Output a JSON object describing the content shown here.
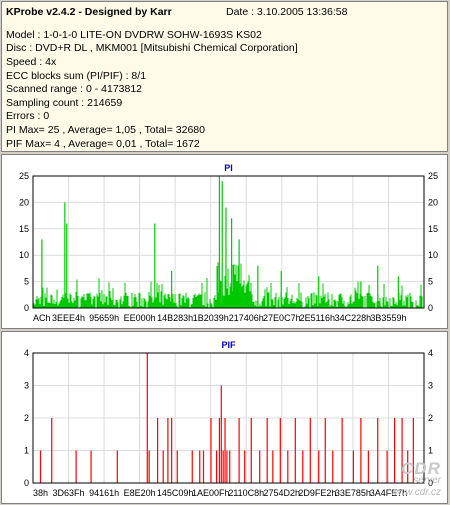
{
  "header": {
    "title": "KProbe v2.4.2 - Designed by Karr",
    "date": "Date : 3.10.2005 13:36:58",
    "lines": [
      "Model : 1-0-1-0 LITE-ON DVDRW SOHW-1693S KS02",
      "Disc : DVD+R DL , MKM001 [Mitsubishi Chemical Corporation]",
      "Speed : 4x",
      "ECC blocks sum (PI/PIF) : 8/1",
      "Scanned range : 0 - 4173812",
      "Sampling count : 214659",
      "Errors : 0",
      "PI Max= 25 , Average= 1,05 , Total= 32680",
      "PIF Max= 4 , Average= 0,01 , Total= 1672"
    ]
  },
  "watermark": {
    "logo": "CDR",
    "sub": "server",
    "url": "www.cdr.cz"
  },
  "colors": {
    "pi": "#00c800",
    "pif": "#ff0000",
    "grid": "#dcdcdc",
    "axis_text": "#000000",
    "title": "#0000c0"
  },
  "chart_data": [
    {
      "type": "bar",
      "title": "PI",
      "ylim": [
        0,
        25
      ],
      "yticks": [
        0,
        5,
        10,
        15,
        20,
        25
      ],
      "x_tick_labels": [
        "ACh",
        "3EEE4h",
        "95659h",
        "EE000h",
        "14B283h",
        "1B2039h",
        "217406h",
        "27E0C7h",
        "2E5116h",
        "34C228h",
        "3B3559h"
      ],
      "x_range": [
        0,
        4173812
      ],
      "peaks": [
        {
          "x": 95000,
          "y": 13
        },
        {
          "x": 340000,
          "y": 20
        },
        {
          "x": 360000,
          "y": 16
        },
        {
          "x": 1300000,
          "y": 16
        },
        {
          "x": 1480000,
          "y": 7
        },
        {
          "x": 1990000,
          "y": 25
        },
        {
          "x": 2020000,
          "y": 24
        },
        {
          "x": 2060000,
          "y": 19
        },
        {
          "x": 2120000,
          "y": 17
        },
        {
          "x": 2200000,
          "y": 13
        },
        {
          "x": 2400000,
          "y": 8
        },
        {
          "x": 2650000,
          "y": 7
        },
        {
          "x": 3050000,
          "y": 6
        },
        {
          "x": 3500000,
          "y": 5
        },
        {
          "x": 3680000,
          "y": 8
        },
        {
          "x": 3900000,
          "y": 6
        }
      ],
      "baseline_average": 1.05
    },
    {
      "type": "bar",
      "title": "PIF",
      "ylim": [
        0,
        4
      ],
      "yticks": [
        0,
        1,
        2,
        3,
        4
      ],
      "x_tick_labels": [
        "38h",
        "3D63Fh",
        "94161h",
        "E8E20h",
        "145C09h",
        "1AE00Fh",
        "2110C8h",
        "2754D2h",
        "2D9FE2h",
        "33E785h",
        "3A4FE7h"
      ],
      "x_range": [
        0,
        4173812
      ],
      "values": [
        {
          "x": 80000,
          "y": 1
        },
        {
          "x": 200000,
          "y": 2
        },
        {
          "x": 460000,
          "y": 1
        },
        {
          "x": 620000,
          "y": 1
        },
        {
          "x": 900000,
          "y": 1
        },
        {
          "x": 1220000,
          "y": 4
        },
        {
          "x": 1240000,
          "y": 1
        },
        {
          "x": 1330000,
          "y": 2
        },
        {
          "x": 1390000,
          "y": 1
        },
        {
          "x": 1440000,
          "y": 2
        },
        {
          "x": 1480000,
          "y": 2
        },
        {
          "x": 1540000,
          "y": 1
        },
        {
          "x": 1700000,
          "y": 1
        },
        {
          "x": 1780000,
          "y": 1
        },
        {
          "x": 1820000,
          "y": 1
        },
        {
          "x": 1900000,
          "y": 2
        },
        {
          "x": 1960000,
          "y": 1
        },
        {
          "x": 1990000,
          "y": 2
        },
        {
          "x": 2010000,
          "y": 3
        },
        {
          "x": 2030000,
          "y": 1
        },
        {
          "x": 2050000,
          "y": 2
        },
        {
          "x": 2070000,
          "y": 1
        },
        {
          "x": 2100000,
          "y": 1
        },
        {
          "x": 2200000,
          "y": 2
        },
        {
          "x": 2260000,
          "y": 1
        },
        {
          "x": 2330000,
          "y": 2
        },
        {
          "x": 2420000,
          "y": 1
        },
        {
          "x": 2500000,
          "y": 2
        },
        {
          "x": 2560000,
          "y": 1
        },
        {
          "x": 2640000,
          "y": 2
        },
        {
          "x": 2720000,
          "y": 1
        },
        {
          "x": 2800000,
          "y": 2
        },
        {
          "x": 2880000,
          "y": 1
        },
        {
          "x": 2960000,
          "y": 2
        },
        {
          "x": 3050000,
          "y": 1
        },
        {
          "x": 3120000,
          "y": 2
        },
        {
          "x": 3200000,
          "y": 1
        },
        {
          "x": 3300000,
          "y": 2
        },
        {
          "x": 3420000,
          "y": 1
        },
        {
          "x": 3500000,
          "y": 2
        },
        {
          "x": 3580000,
          "y": 1
        },
        {
          "x": 3680000,
          "y": 2
        },
        {
          "x": 3780000,
          "y": 1
        },
        {
          "x": 3860000,
          "y": 2
        },
        {
          "x": 3940000,
          "y": 2
        },
        {
          "x": 4000000,
          "y": 1
        },
        {
          "x": 4060000,
          "y": 2
        }
      ]
    }
  ]
}
